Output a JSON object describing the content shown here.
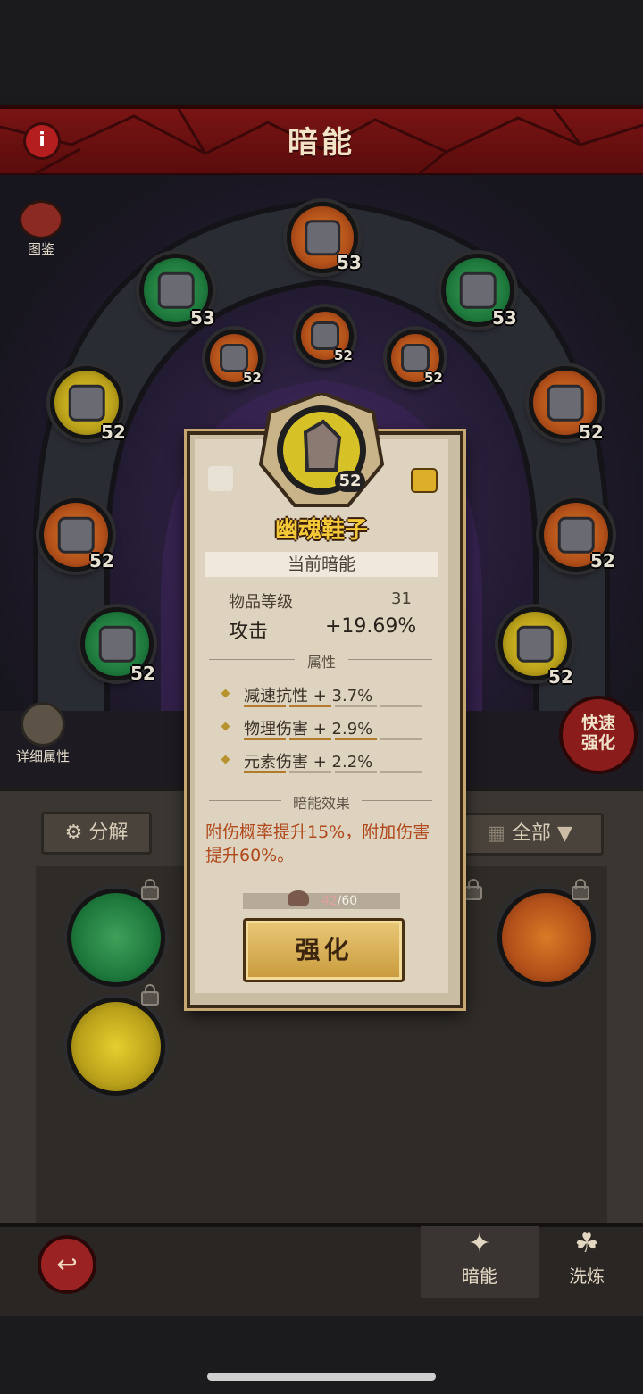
{
  "header": {
    "title": "暗能",
    "info_icon": "i"
  },
  "left_buttons": {
    "codex_label": "图鉴",
    "detail_attrs_label": "详细属性"
  },
  "right_buttons": {
    "quick_upgrade_label": "快速强化"
  },
  "slots": [
    {
      "level": "53",
      "color": "orange"
    },
    {
      "level": "53",
      "color": "green"
    },
    {
      "level": "53",
      "color": "green"
    },
    {
      "level": "52",
      "color": "orange"
    },
    {
      "level": "52",
      "color": "orange"
    },
    {
      "level": "52",
      "color": "orange"
    },
    {
      "level": "52",
      "color": "yellow"
    },
    {
      "level": "52",
      "color": "orange"
    },
    {
      "level": "52",
      "color": "orange"
    },
    {
      "level": "52",
      "color": "orange"
    },
    {
      "level": "52",
      "color": "green"
    },
    {
      "level": "52",
      "color": "yellow"
    }
  ],
  "inventory": {
    "decompose_label": "分解",
    "filter_label": "全部"
  },
  "dialog": {
    "item_level_badge": "52",
    "item_name": "幽魂鞋子",
    "current_section": "当前暗能",
    "item_level_label": "物品等级",
    "item_level_value": "31",
    "attack_label": "攻击",
    "attack_value": "+19.69%",
    "attributes_header": "属性",
    "stats": [
      {
        "text": "减速抗性 + 3.7%",
        "progress": 0.5
      },
      {
        "text": "物理伤害 + 2.9%",
        "progress": 0.75
      },
      {
        "text": "元素伤害 + 2.2%",
        "progress": 0.25
      }
    ],
    "effect_header": "暗能效果",
    "effect_text": "附伤概率提升15%，附加伤害提升60%。",
    "material_current": "42",
    "material_total": "/60",
    "upgrade_label": "强化"
  },
  "bottom_nav": {
    "dark_energy_label": "暗能",
    "refine_label": "洗炼"
  },
  "colors": {
    "header_red": "#6e1010",
    "gold_text": "#f3c93a",
    "effect_text": "#b0481c"
  }
}
